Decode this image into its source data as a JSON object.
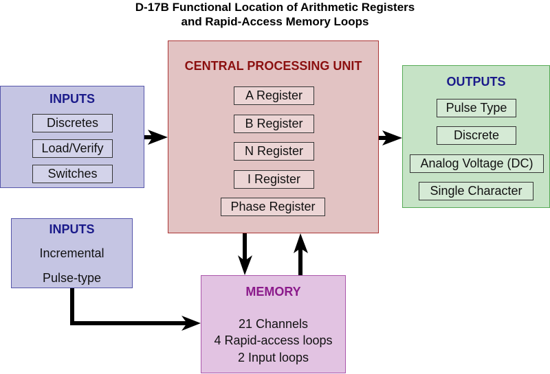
{
  "title": {
    "line1": "D-17B Functional Location of Arithmetic Registers",
    "line2": "and Rapid-Access Memory Loops"
  },
  "inputs_discrete": {
    "header": "INPUTS",
    "items": [
      "Discretes",
      "Load/Verify",
      "Switches"
    ],
    "color": "#c5c5e3"
  },
  "inputs_incremental": {
    "header": "INPUTS",
    "lines": [
      "Incremental",
      "Pulse-type"
    ],
    "color": "#c5c5e3"
  },
  "cpu": {
    "header": "CENTRAL PROCESSING UNIT",
    "items": [
      "A Register",
      "B Register",
      "N Register",
      "I Register",
      "Phase Register"
    ],
    "color": "#e2c3c3"
  },
  "outputs": {
    "header": "OUTPUTS",
    "items": [
      "Pulse Type",
      "Discrete",
      "Analog Voltage (DC)",
      "Single Character"
    ],
    "color": "#c6e3c6"
  },
  "memory": {
    "header": "MEMORY",
    "lines": [
      "21 Channels",
      "4 Rapid-access loops",
      "2 Input loops"
    ],
    "color": "#e2c3e2"
  },
  "colors": {
    "input_header": "#1a1a8a",
    "cpu_header": "#8b1010",
    "output_header": "#1a1a8a",
    "memory_header": "#8b1a8b"
  }
}
